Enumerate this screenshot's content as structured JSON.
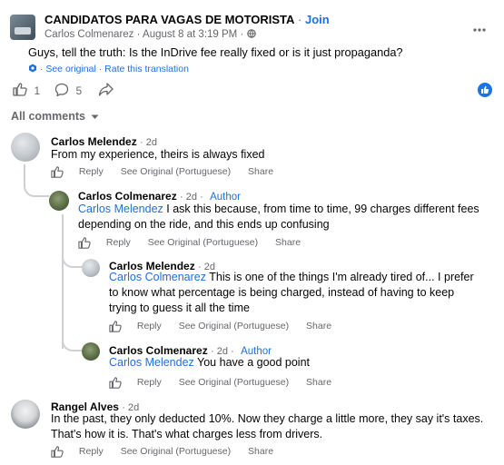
{
  "post": {
    "group_name": "CANDIDATOS PARA VAGAS DE MOTORISTA",
    "separator": "·",
    "join_label": "Join",
    "author": "Carlos Colmenarez",
    "time": "August 8 at 3:19 PM",
    "text": "Guys, tell the truth: Is the InDrive fee really fixed or is it just propaganda?",
    "see_original": "See original",
    "rate_translation": "Rate this translation",
    "like_count": "1",
    "comment_count": "5"
  },
  "comments_header": "All comments",
  "actions": {
    "reply": "Reply",
    "see_original": "See Original (Portuguese)",
    "share": "Share"
  },
  "comments": [
    {
      "author": "Carlos Melendez",
      "time": "2d",
      "text": "From my experience, theirs is always fixed"
    },
    {
      "author": "Carlos Colmenarez",
      "time": "2d",
      "badge": "Author",
      "mention": "Carlos Melendez",
      "text_line1": " I ask this because, from time to time, 99 charges different fees",
      "text_line2": "depending on the ride, and this ends up confusing"
    },
    {
      "author": "Carlos Melendez",
      "time": "2d",
      "mention": "Carlos Colmenarez",
      "text_line1": " This is one of the things I'm already tired of... I prefer",
      "text_line2": "to know what percentage is being charged, instead of having to keep",
      "text_line3": "trying to guess it all the time"
    },
    {
      "author": "Carlos Colmenarez",
      "time": "2d",
      "badge": "Author",
      "mention": "Carlos Melendez",
      "text_line1": " You have a good point"
    },
    {
      "author": "Rangel Alves",
      "time": "2d",
      "text_line1": "In the past, they only deducted 10%. Now they charge a little more, they say it's taxes.",
      "text_line2": "That's how it is. That's what charges less from drivers."
    }
  ]
}
